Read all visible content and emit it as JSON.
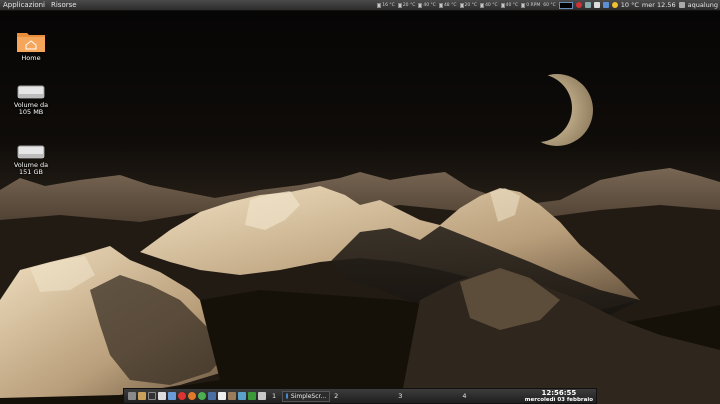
{
  "top_panel": {
    "menu": [
      "Applicazioni",
      "Risorse"
    ],
    "sensors": [
      "16 °C",
      "20 °C",
      "40 °C",
      "48 °C",
      "20 °C",
      "40 °C",
      "40 °C"
    ],
    "fan_speed": "0 RPM",
    "sensor_extra": "60 °C",
    "weather": "10 °C",
    "clock": "mer 12.56",
    "user": "aqualung"
  },
  "desktop_icons": [
    {
      "label": "Home",
      "icon": "home-folder-icon"
    },
    {
      "label": "Volume da\n105 MB",
      "icon": "drive-icon"
    },
    {
      "label": "Volume da\n151 GB",
      "icon": "drive-icon"
    }
  ],
  "bottom_panel": {
    "workspaces": [
      "1",
      "2",
      "3",
      "4"
    ],
    "task_label": "SimpleScr...",
    "time": "12:56:55",
    "date": "mercoledì 03 febbraio"
  },
  "colors": {
    "panel": "#2c2c2c",
    "folder": "#f0a050",
    "moon": "#d9c8a0",
    "mountain_light": "#e8d6b4"
  }
}
